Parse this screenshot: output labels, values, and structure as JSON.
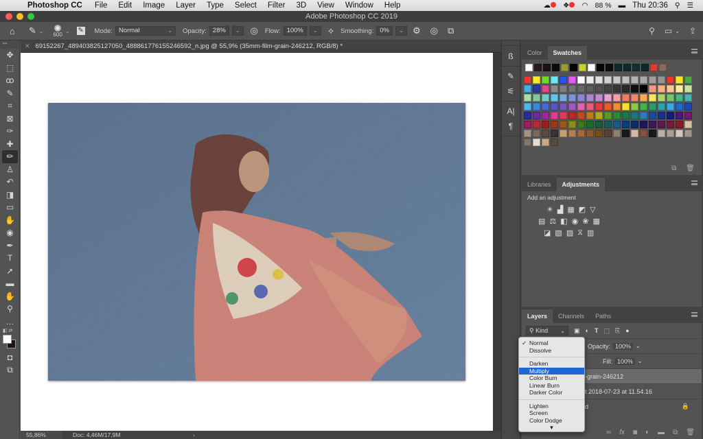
{
  "menubar": {
    "app": "Photoshop CC",
    "menus": [
      "File",
      "Edit",
      "Image",
      "Layer",
      "Type",
      "Select",
      "Filter",
      "3D",
      "View",
      "Window",
      "Help"
    ],
    "battery": "88 %",
    "clock": "Thu 20:36"
  },
  "titlebar": {
    "title": "Adobe Photoshop CC 2019"
  },
  "options": {
    "brush_size": "600",
    "mode_label": "Mode:",
    "mode_value": "Normal",
    "opacity_label": "Opacity:",
    "opacity_value": "28%",
    "flow_label": "Flow:",
    "flow_value": "100%",
    "smoothing_label": "Smoothing:",
    "smoothing_value": "0%"
  },
  "tools": [
    {
      "name": "move-tool",
      "glyph": "✥"
    },
    {
      "name": "marquee-tool",
      "glyph": "⬚"
    },
    {
      "name": "lasso-tool",
      "glyph": "ꝏ"
    },
    {
      "name": "quick-select-tool",
      "glyph": "✎"
    },
    {
      "name": "crop-tool",
      "glyph": "⌗"
    },
    {
      "name": "frame-tool",
      "glyph": "⊠"
    },
    {
      "name": "eyedropper-tool",
      "glyph": "✑"
    },
    {
      "name": "healing-brush-tool",
      "glyph": "✚"
    },
    {
      "name": "brush-tool",
      "glyph": "✏",
      "active": true
    },
    {
      "name": "clone-stamp-tool",
      "glyph": "♙"
    },
    {
      "name": "history-brush-tool",
      "glyph": "↶"
    },
    {
      "name": "eraser-tool",
      "glyph": "◨"
    },
    {
      "name": "gradient-tool",
      "glyph": "▭"
    },
    {
      "name": "blur-tool",
      "glyph": "✋"
    },
    {
      "name": "dodge-tool",
      "glyph": "◉"
    },
    {
      "name": "pen-tool",
      "glyph": "✒"
    },
    {
      "name": "type-tool",
      "glyph": "T"
    },
    {
      "name": "path-select-tool",
      "glyph": "➚"
    },
    {
      "name": "rectangle-tool",
      "glyph": "▬"
    },
    {
      "name": "hand-tool",
      "glyph": "✋"
    },
    {
      "name": "zoom-tool",
      "glyph": "⚲"
    },
    {
      "name": "more-tools",
      "glyph": "…"
    }
  ],
  "document": {
    "tab_title": "69152267_489403825127050_488861776155246592_n.jpg @ 55,9% (35mm-film-grain-246212, RGB/8) *",
    "zoom": "55,86%",
    "doc_info": "Doc: 4,46M/17,9M"
  },
  "swatches_panel": {
    "tabs": [
      "Color",
      "Swatches"
    ],
    "active_tab": "Swatches",
    "recent": [
      "#ffffff",
      "#2a1a1e",
      "#1a1214",
      "#0b0b0b",
      "#9a9a2e",
      "#050505",
      "#c7d22a",
      "#ffffff",
      "#060606",
      "#120a0c",
      "#0f2a2a",
      "#0f2b2b",
      "#133030",
      "#0f2828",
      "#e33b2e",
      "#8a6a5a"
    ],
    "grid": [
      "#ea3b2f",
      "#f8ec2c",
      "#6edb2c",
      "#6ee8f0",
      "#2a52f0",
      "#e05cf0",
      "#ffffff",
      "#ececec",
      "#dedede",
      "#d2d2d2",
      "#c8c8c8",
      "#bdbdbd",
      "#b2b2b2",
      "#a8a8a8",
      "#9e9e9e",
      "#949494",
      "#e8382e",
      "#f5e62c",
      "#4da84a",
      "#43aee8",
      "#2c3aa8",
      "#e0488e",
      "#8a8a8a",
      "#7e7e7e",
      "#737373",
      "#686868",
      "#5c5c5c",
      "#505050",
      "#444444",
      "#383838",
      "#2a2a2a",
      "#101010",
      "#000000",
      "#f29a80",
      "#f5b088",
      "#f7c892",
      "#fbf09a",
      "#c6e3a0",
      "#a8dca8",
      "#82c8a0",
      "#74ccc8",
      "#66c4f0",
      "#7aa8e0",
      "#7a92d6",
      "#8a86cc",
      "#a88ad0",
      "#c08ad0",
      "#f0a0cc",
      "#f4a0a8",
      "#f07a6a",
      "#f2886a",
      "#f7a85a",
      "#f5e65c",
      "#a8d66a",
      "#74c474",
      "#48b48a",
      "#46b4b4",
      "#4ab8f0",
      "#3a88d8",
      "#4a6ad0",
      "#5a56c0",
      "#7a56c0",
      "#a058c0",
      "#e062b0",
      "#ea5a7a",
      "#e83c38",
      "#ea5c2c",
      "#f0902c",
      "#f6e02a",
      "#8cc84a",
      "#48b048",
      "#2a9c6a",
      "#2aa4a4",
      "#3aa8e8",
      "#1e6ac8",
      "#1e48b0",
      "#2a2a9c",
      "#6a2aa0",
      "#9a2a98",
      "#e03c8c",
      "#e03c5a",
      "#b82a2a",
      "#c04a1e",
      "#c07a1e",
      "#b0aa1e",
      "#5a9a2a",
      "#2a8a3a",
      "#1a7a4a",
      "#1a7878",
      "#2a7ab8",
      "#1a4a9a",
      "#1a3088",
      "#1a1a78",
      "#4a1a7a",
      "#701a6a",
      "#a01a5a",
      "#b8283a",
      "#981e1e",
      "#983a1a",
      "#9a5a1a",
      "#8c8c1a",
      "#3a7a1a",
      "#1a6a2a",
      "#1a5a3a",
      "#1a5a5a",
      "#1a5a8a",
      "#0f3a7a",
      "#0f2a6a",
      "#1a1a5a",
      "#3a1a5a",
      "#5a1a4a",
      "#7a1a3a",
      "#8a1a2a",
      "#d8c0a8",
      "#a89080",
      "#7a6a5a",
      "#5a4a40",
      "#3a3230",
      "#c8a070",
      "#b08050",
      "#a06a3a",
      "#8a5a2a",
      "#7a4a1a",
      "#5a4030",
      "#8a8070",
      "#1a1a1a",
      "#d8b8a0",
      "#8a5040",
      "#1a1a1c",
      "#b8b0a8",
      "#a8a098",
      "#d0c8c0",
      "#a09890",
      "#807870",
      "#e6ddd0",
      "#c4aa88",
      "#5a4a3a"
    ]
  },
  "adjustments_panel": {
    "tabs": [
      "Libraries",
      "Adjustments"
    ],
    "active_tab": "Adjustments",
    "title": "Add an adjustment",
    "rows": [
      [
        "brightness-contrast",
        "levels",
        "curves",
        "exposure",
        "vibrance"
      ],
      [
        "hue-saturation",
        "color-balance",
        "black-white",
        "photo-filter",
        "channel-mixer",
        "color-lookup"
      ],
      [
        "invert",
        "posterize",
        "threshold",
        "selective-color",
        "gradient-map"
      ]
    ],
    "glyphs": [
      [
        "☀",
        "▟",
        "▦",
        "◩",
        "▽"
      ],
      [
        "▤",
        "⚖",
        "◧",
        "◉",
        "❀",
        "▦"
      ],
      [
        "◪",
        "▧",
        "▨",
        "⧖",
        "▥"
      ]
    ]
  },
  "layers_panel": {
    "tabs": [
      "Layers",
      "Channels",
      "Paths"
    ],
    "active_tab": "Layers",
    "filter_kind": "Kind",
    "opacity_label": "Opacity:",
    "opacity_value": "100%",
    "fill_label": "Fill:",
    "fill_value": "100%",
    "layers": [
      {
        "name": "35mm-film-grain-246212",
        "visible_text": "-grain-246212",
        "selected": true
      },
      {
        "name": "Screenshot 2018-07-23 at 11.54.16",
        "visible_text": "t 2018-07-23 at 11.54.16",
        "selected": false
      },
      {
        "name": "Background",
        "visible_text": "d",
        "selected": false,
        "locked": true
      }
    ]
  },
  "blend_dropdown": {
    "groups": [
      [
        "Normal",
        "Dissolve"
      ],
      [
        "Darken",
        "Multiply",
        "Color Burn",
        "Linear Burn",
        "Darker Color"
      ],
      [
        "Lighten",
        "Screen",
        "Color Dodge"
      ]
    ],
    "checked": "Normal",
    "highlighted": "Multiply"
  }
}
